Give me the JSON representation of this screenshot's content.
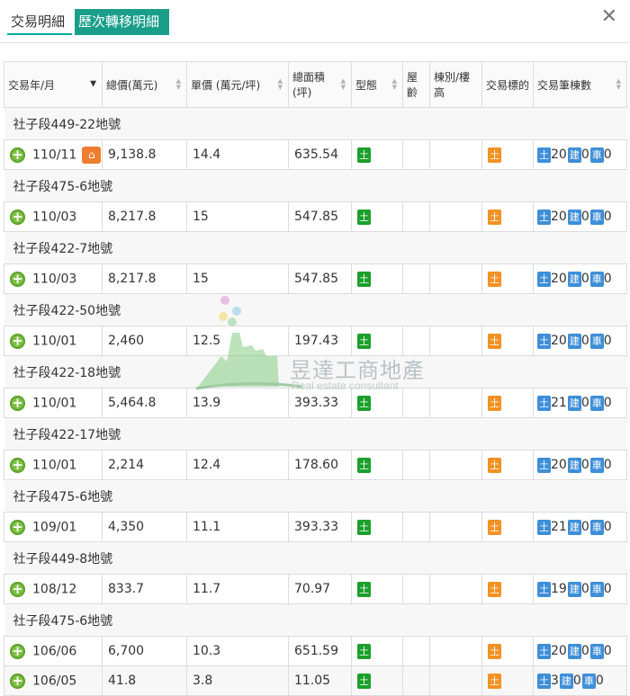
{
  "tabs": [
    "交易明細",
    "歷次轉移明細"
  ],
  "close_label": "✕",
  "columns": [
    "交易年/月",
    "總價(萬元)",
    "單價 (萬元/坪)",
    "總面積\n(坪)",
    "型態",
    "屋齡",
    "棟別/樓高",
    "交易標的",
    "交易筆棟數"
  ],
  "badge_letters": {
    "land": "土",
    "building": "建",
    "parking": "車"
  },
  "colors": {
    "type_badge": "#1b9f2b",
    "target_badge": "#f29124",
    "count_badge": "#3e8ed8",
    "add_button": "#7cc043",
    "house_icon": "#ef7d2f",
    "active_tab": "#1a9e89"
  },
  "watermark": {
    "title": "昱達工商地產",
    "subtitle": "Real estate consultant"
  },
  "records": [
    {
      "lot": "社子段449-22地號",
      "date": "110/11",
      "total": "9,138.8",
      "unit": "14.4",
      "area": "635.54",
      "land_count": "20",
      "building_count": "0",
      "parking_count": "0",
      "has_house_icon": true
    },
    {
      "lot": "社子段475-6地號",
      "date": "110/03",
      "total": "8,217.8",
      "unit": "15",
      "area": "547.85",
      "land_count": "20",
      "building_count": "0",
      "parking_count": "0"
    },
    {
      "lot": "社子段422-7地號",
      "date": "110/03",
      "total": "8,217.8",
      "unit": "15",
      "area": "547.85",
      "land_count": "20",
      "building_count": "0",
      "parking_count": "0"
    },
    {
      "lot": "社子段422-50地號",
      "date": "110/01",
      "total": "2,460",
      "unit": "12.5",
      "area": "197.43",
      "land_count": "20",
      "building_count": "0",
      "parking_count": "0"
    },
    {
      "lot": "社子段422-18地號",
      "date": "110/01",
      "total": "5,464.8",
      "unit": "13.9",
      "area": "393.33",
      "land_count": "21",
      "building_count": "0",
      "parking_count": "0"
    },
    {
      "lot": "社子段422-17地號",
      "date": "110/01",
      "total": "2,214",
      "unit": "12.4",
      "area": "178.60",
      "land_count": "20",
      "building_count": "0",
      "parking_count": "0"
    },
    {
      "lot": "社子段475-6地號",
      "date": "109/01",
      "total": "4,350",
      "unit": "11.1",
      "area": "393.33",
      "land_count": "21",
      "building_count": "0",
      "parking_count": "0"
    },
    {
      "lot": "社子段449-8地號",
      "date": "108/12",
      "total": "833.7",
      "unit": "11.7",
      "area": "70.97",
      "land_count": "19",
      "building_count": "0",
      "parking_count": "0"
    },
    {
      "lot": "社子段475-6地號",
      "date": "106/06",
      "total": "6,700",
      "unit": "10.3",
      "area": "651.59",
      "land_count": "20",
      "building_count": "0",
      "parking_count": "0"
    },
    {
      "lot": "",
      "date": "106/05",
      "total": "41.8",
      "unit": "3.8",
      "area": "11.05",
      "land_count": "3",
      "building_count": "0",
      "parking_count": "0"
    }
  ]
}
